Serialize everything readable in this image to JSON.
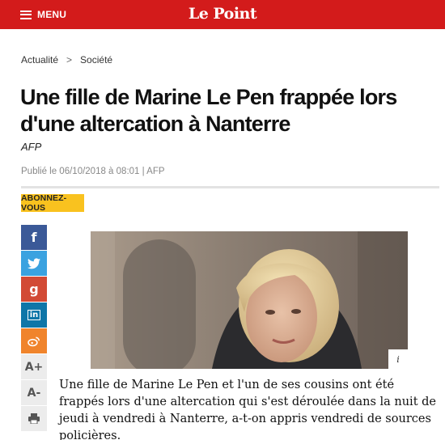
{
  "header": {
    "menu_label": "MENU",
    "logo_text": "Le Point",
    "brand_color": "#d31b1b"
  },
  "breadcrumb": {
    "items": [
      "Actualité",
      "Société"
    ],
    "separator": ">"
  },
  "article": {
    "title": "Une fille de Marine Le Pen frappée lors d'une altercation à Nanterre",
    "author": "AFP",
    "meta": "Publié le 06/10/2018 à 08:01 | AFP",
    "lead": "Une fille de Marine Le Pen et l'un de ses cousins ont été frappés lors d'une altercation qui s'est déroulée dans la nuit de jeudi à vendredi à Nanterre, a-t-on appris vendredi de sources policières."
  },
  "subscribe": {
    "label": "ABONNEZ-VOUS",
    "color": "#f9c21f"
  },
  "share": {
    "facebook": "f",
    "twitter_icon": "twitter-bird-icon",
    "googleplus": "g",
    "linkedin": "in",
    "weibo_icon": "weibo-icon",
    "font_increase": "A+",
    "font_decrease": "A-",
    "print_icon": "printer-icon"
  },
  "photo": {
    "info_label": "i"
  }
}
